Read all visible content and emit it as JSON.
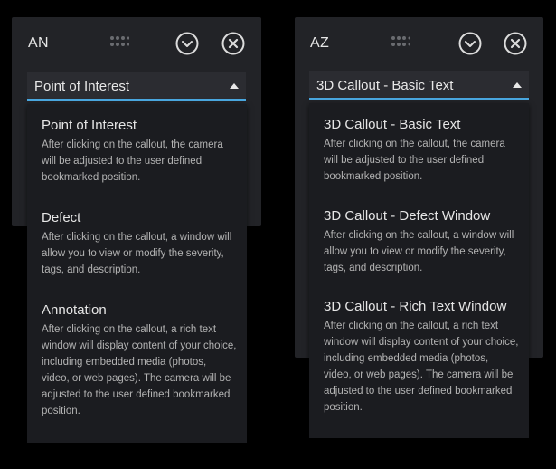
{
  "left_panel": {
    "title": "AN",
    "selected": "Point of Interest",
    "options": [
      {
        "title": "Point of Interest",
        "desc": "After clicking on the callout, the camera will be adjusted to the user defined bookmarked position."
      },
      {
        "title": "Defect",
        "desc": "After clicking on the callout, a window will allow you to view or modify the severity, tags, and description."
      },
      {
        "title": "Annotation",
        "desc": "After clicking on the callout, a rich text window will display content of your choice, including embedded media (photos, video, or web pages). The camera will be adjusted to the user defined bookmarked position."
      }
    ]
  },
  "right_panel": {
    "title": "AZ",
    "selected": "3D Callout - Basic Text",
    "options": [
      {
        "title": "3D Callout - Basic Text",
        "desc": "After clicking on the callout, the camera will be adjusted to the user defined bookmarked position."
      },
      {
        "title": "3D Callout - Defect Window",
        "desc": "After clicking on the callout, a window will allow you to view or modify the severity, tags, and description."
      },
      {
        "title": "3D Callout - Rich Text Window",
        "desc": "After clicking on the callout, a rich text window will display content of your choice, including embedded media (photos, video, or web pages). The camera will be adjusted to the user defined bookmarked position."
      }
    ]
  },
  "icons": {
    "grip": "drag-grip-icon",
    "collapse": "chevron-down-circle-icon",
    "close": "close-circle-icon"
  },
  "colors": {
    "page_bg": "#000000",
    "panel_bg": "#222327",
    "menu_bg": "#1b1c20",
    "accent": "#4aa8e0"
  }
}
